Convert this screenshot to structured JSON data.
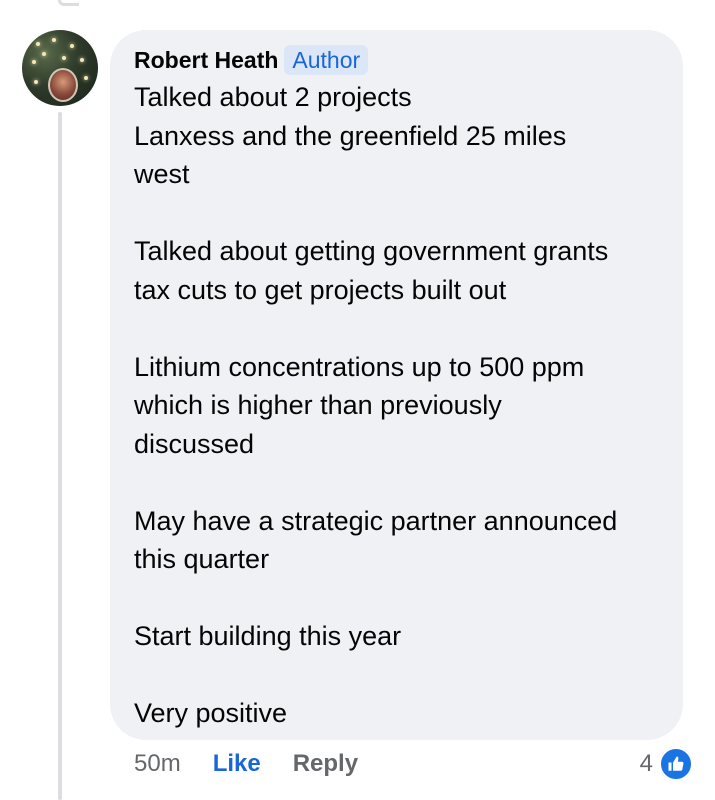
{
  "comment": {
    "author": "Robert Heath",
    "badge": "Author",
    "paragraphs": [
      [
        "Talked about 2 projects",
        "Lanxess and the greenfield 25 miles",
        "west"
      ],
      [
        "Talked about getting government grants",
        "tax cuts to get projects built out"
      ],
      [
        "Lithium concentrations up to 500 ppm",
        "which is higher than previously",
        "discussed"
      ],
      [
        "May have a strategic partner announced",
        "this quarter"
      ],
      [
        "Start building this year"
      ],
      [
        "Very positive"
      ]
    ],
    "timestamp": "50m",
    "like_label": "Like",
    "reply_label": "Reply",
    "reaction_count": "4",
    "reaction_icon": "thumbs-up-icon"
  },
  "colors": {
    "bubble": "#f0f1f5",
    "link_blue": "#1b66d6",
    "badge_bg": "#dbe7f9",
    "muted": "#65676b"
  }
}
